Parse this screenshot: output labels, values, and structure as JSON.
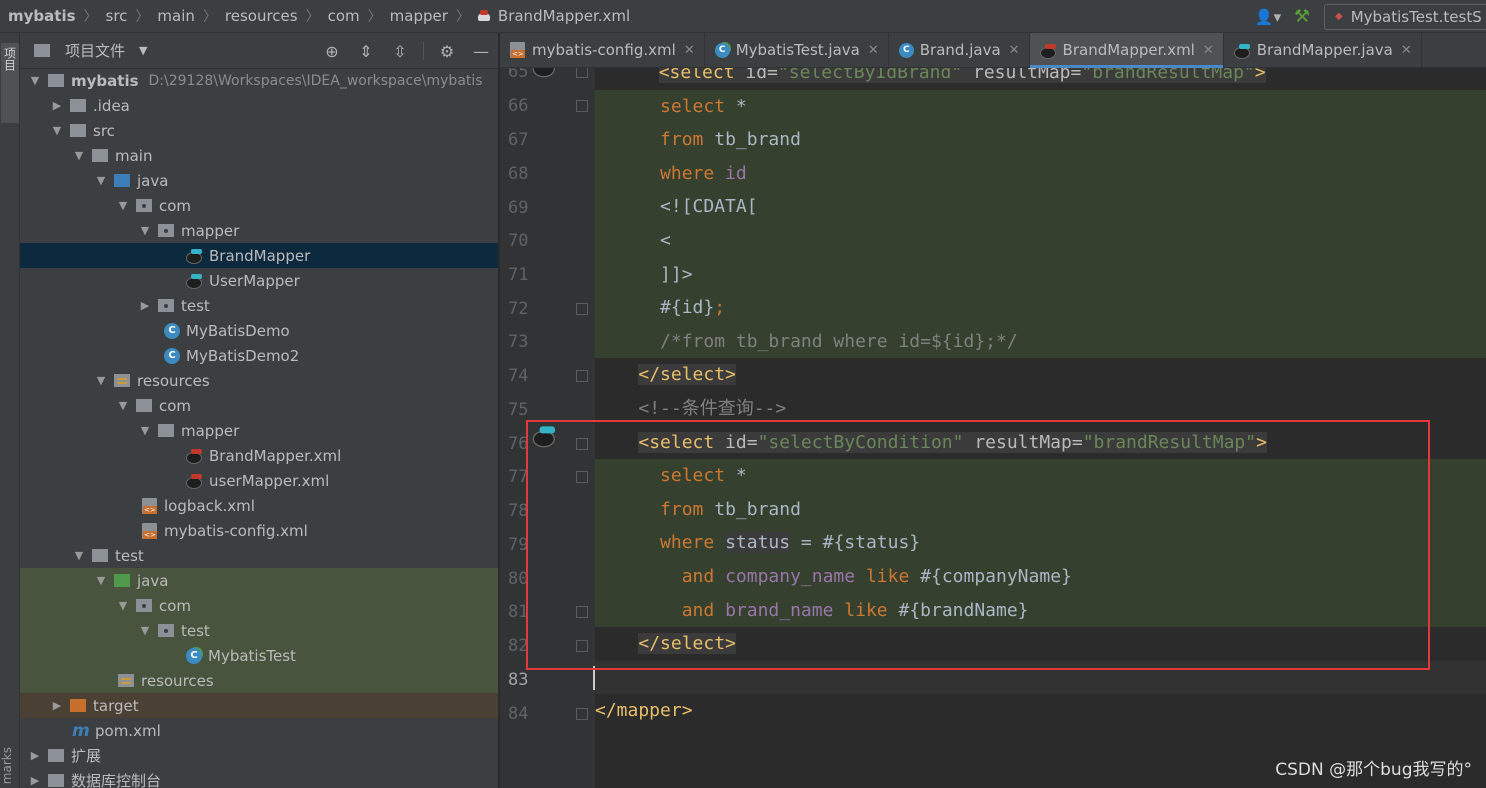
{
  "breadcrumb": {
    "items": [
      "mybatis",
      "src",
      "main",
      "resources",
      "com",
      "mapper",
      "BrandMapper.xml"
    ]
  },
  "toolbar": {
    "run_config": "MybatisTest.testS"
  },
  "stripe": {
    "project_label": "项目",
    "bookmarks_label": "marks"
  },
  "project_panel": {
    "title": "项目文件",
    "tree": [
      {
        "label": "mybatis",
        "path": "D:\\29128\\Workspaces\\IDEA_workspace\\mybatis"
      },
      {
        "label": ".idea"
      },
      {
        "label": "src"
      },
      {
        "label": "main"
      },
      {
        "label": "java"
      },
      {
        "label": "com"
      },
      {
        "label": "mapper"
      },
      {
        "label": "BrandMapper"
      },
      {
        "label": "UserMapper"
      },
      {
        "label": "test"
      },
      {
        "label": "MyBatisDemo"
      },
      {
        "label": "MyBatisDemo2"
      },
      {
        "label": "resources"
      },
      {
        "label": "com"
      },
      {
        "label": "mapper"
      },
      {
        "label": "BrandMapper.xml"
      },
      {
        "label": "userMapper.xml"
      },
      {
        "label": "logback.xml"
      },
      {
        "label": "mybatis-config.xml"
      },
      {
        "label": "test"
      },
      {
        "label": "java"
      },
      {
        "label": "com"
      },
      {
        "label": "test"
      },
      {
        "label": "MybatisTest"
      },
      {
        "label": "resources"
      },
      {
        "label": "target"
      },
      {
        "label": "pom.xml"
      },
      {
        "label": "扩展"
      },
      {
        "label": "数据库控制台"
      }
    ]
  },
  "tabs": [
    {
      "label": "mybatis-config.xml"
    },
    {
      "label": "MybatisTest.java"
    },
    {
      "label": "Brand.java"
    },
    {
      "label": "BrandMapper.xml"
    },
    {
      "label": "BrandMapper.java"
    }
  ],
  "editor": {
    "line_numbers": [
      "65",
      "66",
      "67",
      "68",
      "69",
      "70",
      "71",
      "72",
      "73",
      "74",
      "75",
      "76",
      "77",
      "78",
      "79",
      "80",
      "81",
      "82",
      "83",
      "84"
    ],
    "code": {
      "l65": [
        "<select",
        " id=",
        "\"selectByIdBrand\"",
        " resultMap=",
        "\"brandResultMap\"",
        ">"
      ],
      "l66": [
        "select",
        " *"
      ],
      "l67": [
        "from",
        " tb_brand"
      ],
      "l68": [
        "where",
        " id"
      ],
      "l69": "<![CDATA[",
      "l70": "<",
      "l71": "]]>",
      "l72": [
        "#{id}",
        ";"
      ],
      "l73": "/*from tb_brand where id=${id};*/",
      "l74": "</select>",
      "l75": "<!--条件查询-->",
      "l76": [
        "<select",
        " id=",
        "\"selectByCondition\"",
        " resultMap=",
        "\"brandResultMap\"",
        ">"
      ],
      "l77": [
        "select",
        " *"
      ],
      "l78": [
        "from",
        " tb_brand"
      ],
      "l79": [
        "where",
        "status",
        " = #{status}"
      ],
      "l80": [
        "and",
        "company_name",
        "like",
        " #{companyName}"
      ],
      "l81": [
        "and",
        "brand_name",
        "like",
        " #{brandName}"
      ],
      "l82": "</select>",
      "l84": "</mapper>"
    }
  },
  "watermark": "CSDN @那个bug我写的°"
}
